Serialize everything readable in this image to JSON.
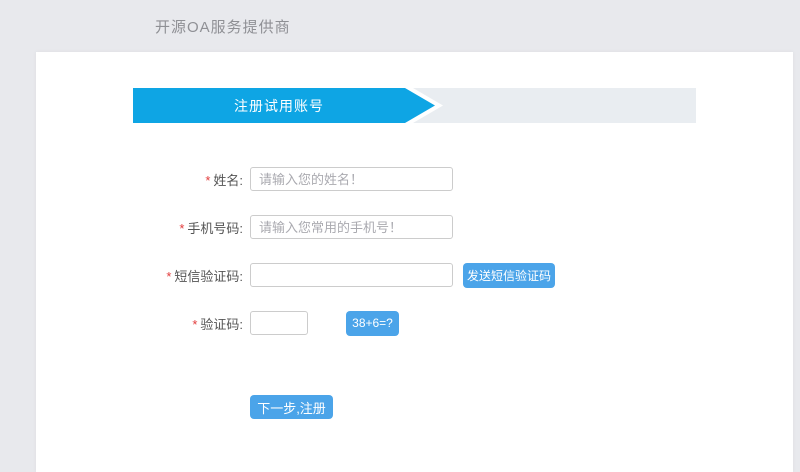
{
  "page": {
    "background_color": "#e8e9ed",
    "header": {
      "brand": "开源OA服务提供商"
    },
    "banner": {
      "title": "注册试用账号",
      "accent_color": "#0ea5e4",
      "bar_color": "#e9edf1"
    },
    "form": {
      "required_marker": "*",
      "fields": [
        {
          "label": "姓名:",
          "placeholder": "请输入您的姓名！",
          "value": ""
        },
        {
          "label": "手机号码:",
          "placeholder": "请输入您常用的手机号！",
          "value": ""
        },
        {
          "label": "短信验证码:",
          "placeholder": "",
          "value": "",
          "button_label": "发送短信验证码"
        },
        {
          "label": "验证码:",
          "placeholder": "",
          "value": "",
          "button_label": "38+6=?"
        }
      ],
      "button_color": "#4ba4e9",
      "submit_label": "下一步,注册"
    }
  }
}
